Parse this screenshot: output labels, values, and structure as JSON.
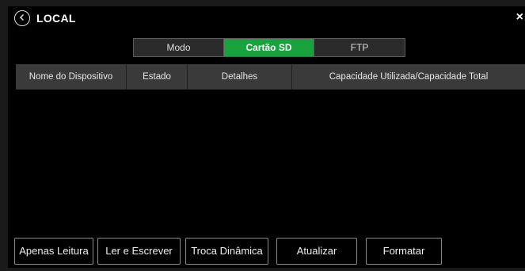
{
  "dialog": {
    "title": "LOCAL",
    "back_icon": "chevron-left-circle-icon",
    "close_label": "×"
  },
  "tabs": [
    {
      "label": "Modo",
      "active": false
    },
    {
      "label": "Cartão SD",
      "active": true
    },
    {
      "label": "FTP",
      "active": false
    }
  ],
  "table": {
    "columns": [
      "Nome do Dispositivo",
      "Estado",
      "Detalhes",
      "Capacidade Utilizada/Capacidade Total"
    ],
    "rows": []
  },
  "buttons": {
    "read_only": "Apenas Leitura",
    "read_write": "Ler e Escrever",
    "hot_swap": "Troca Dinâmica",
    "refresh": "Atualizar",
    "format": "Formatar"
  },
  "colors": {
    "active_tab": "#19a33f",
    "header_bg": "#3a3a3a",
    "background": "#000000"
  }
}
